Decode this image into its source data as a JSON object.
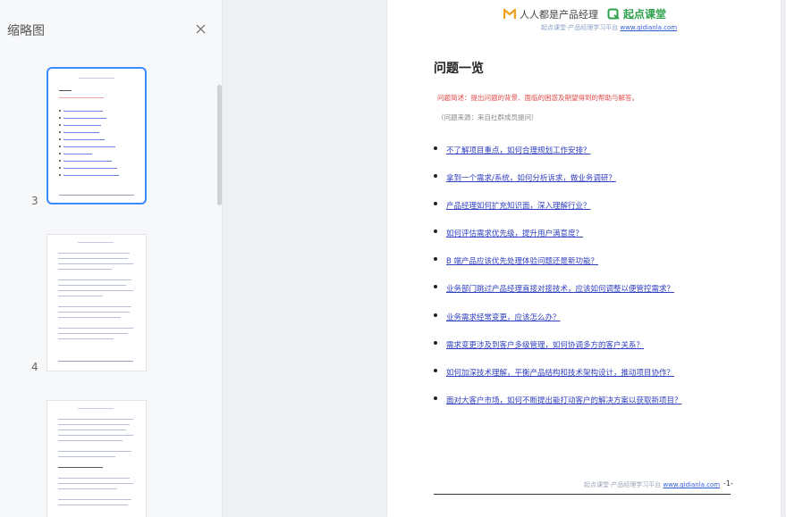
{
  "sidebar": {
    "title": "缩略图",
    "close_icon": "close-icon",
    "thumbnails": [
      {
        "page_label": "3",
        "active": true
      },
      {
        "page_label": "4",
        "active": false
      },
      {
        "page_label": "",
        "active": false
      }
    ]
  },
  "page": {
    "brand_left": "人人都是产品经理",
    "brand_right": "起点课堂",
    "header_sub": "起点课堂·产品经理学习平台",
    "header_link": "www.qidianla.com",
    "title": "问题一览",
    "red_note": "问题简述：提出问题的背景、面临的困惑及期望得到的帮助与解答。",
    "gray_note": "（问题来源：来自社群成员提问）",
    "questions": [
      "不了解项目重点，如何合理规划工作安排？",
      "拿到一个需求/系统，如何分析诉求，做业务调研？",
      "产品经理如何扩充知识面，深入理解行业？",
      "如何评估需求优先级，提升用户满意度？",
      "B 端产品应该优先处理体验问题还是新功能？",
      "业务部门跳过产品经理直接对接技术，应该如何调整以便管控需求？",
      "业务需求经常变更，应该怎么办？",
      "需求变更涉及到客户多级管理，如何协调多方的客户关系？",
      "如何加深技术理解，平衡产品结构和技术架构设计，推动项目协作？",
      "面对大客户市场，如何不断提出能打动客户的解决方案以获取新项目？"
    ],
    "footer_text": "起点课堂·产品经理学习平台",
    "footer_link": "www.qidianla.com",
    "footer_page": "-1-"
  },
  "colors": {
    "accent": "#3b8cff",
    "link": "#2f3fbf",
    "note_red": "#e04a4a",
    "brand_green": "#2da24c"
  }
}
